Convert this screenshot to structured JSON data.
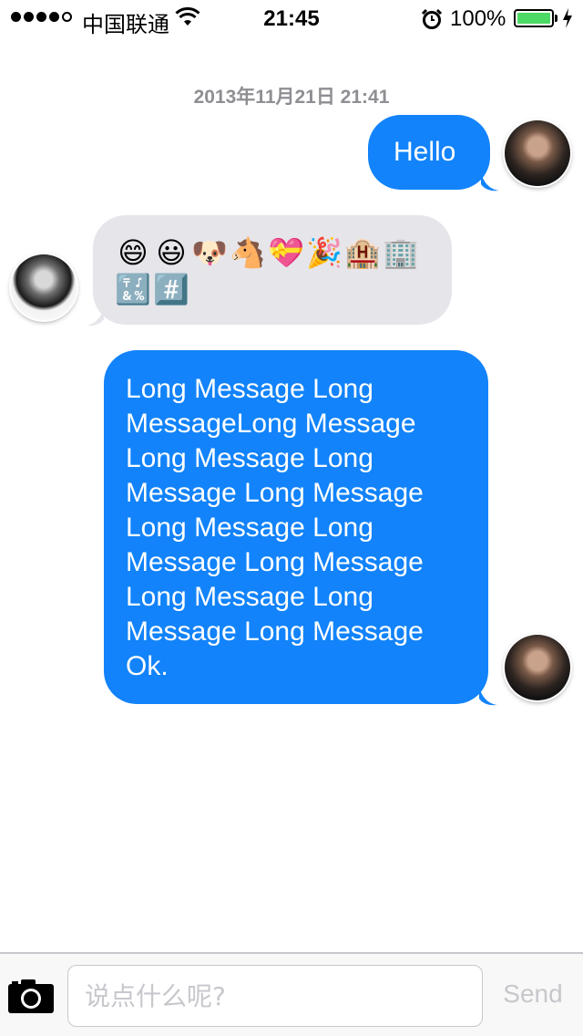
{
  "status_bar": {
    "carrier": "中国联通",
    "time": "21:45",
    "battery_percent": "100%",
    "battery_level": 1.0,
    "signal_bars_filled": 4,
    "signal_bars_total": 5,
    "icons": [
      "signal-dots-icon",
      "wifi-icon",
      "alarm-icon",
      "battery-icon",
      "charging-bolt-icon"
    ]
  },
  "chat": {
    "timestamp": "2013年11月21日 21:41",
    "messages": [
      {
        "direction": "outgoing",
        "sender_avatar": "avatar-woz",
        "text": "Hello"
      },
      {
        "direction": "incoming",
        "sender_avatar": "avatar-jobs",
        "emoji": [
          "😄",
          "😃",
          "🐶",
          "🐴",
          "💝",
          "🎉",
          "🏨",
          "🏢",
          "🔣",
          "#️⃣"
        ]
      },
      {
        "direction": "outgoing",
        "sender_avatar": "avatar-woz",
        "text": "Long Message Long MessageLong Message Long Message Long Message Long Message Long Message Long Message Long Message Long Message Long Message Long Message Ok."
      }
    ]
  },
  "input_bar": {
    "placeholder": "说点什么呢?",
    "value": "",
    "send_label": "Send",
    "camera_icon": "camera-icon"
  },
  "colors": {
    "outgoing_bubble": "#1283fa",
    "incoming_bubble": "#e5e5ea",
    "timestamp": "#8e8e93",
    "send_disabled": "#c7c7cc",
    "battery_fill": "#4cd964"
  }
}
